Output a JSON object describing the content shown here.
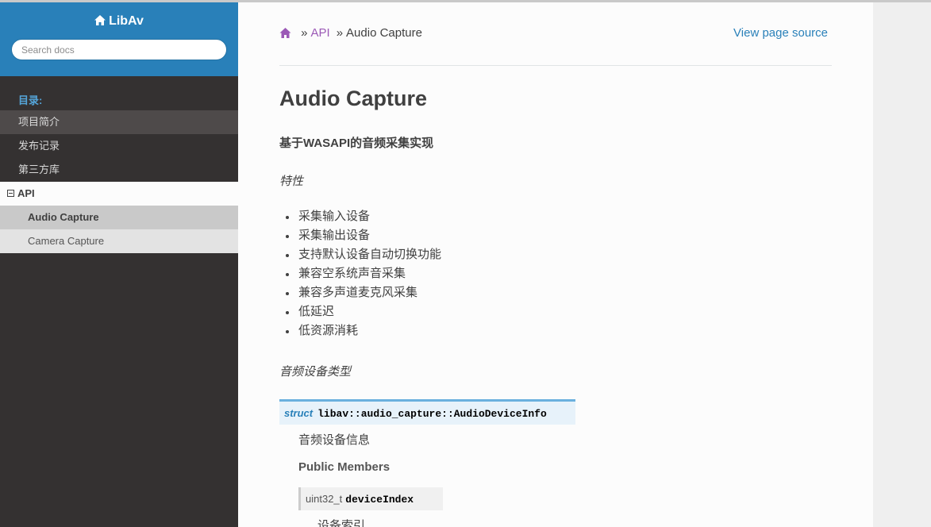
{
  "sidebar": {
    "brand": "LibAv",
    "search_placeholder": "Search docs",
    "caption": "目录:",
    "items": [
      {
        "label": "项目简介"
      },
      {
        "label": "发布记录"
      },
      {
        "label": "第三方库"
      },
      {
        "label": "API"
      },
      {
        "label": "Audio Capture"
      },
      {
        "label": "Camera Capture"
      }
    ]
  },
  "breadcrumb": {
    "sep1": "»",
    "api": "API",
    "sep2": "»",
    "current": "Audio Capture",
    "view_source": "View page source"
  },
  "main": {
    "title": "Audio Capture",
    "subtitle": "基于WASAPI的音频采集实现",
    "features_heading": "特性",
    "features": [
      "采集输入设备",
      "采集输出设备",
      "支持默认设备自动切换功能",
      "兼容空系统声音采集",
      "兼容多声道麦克风采集",
      "低延迟",
      "低资源消耗"
    ],
    "device_types_heading": "音频设备类型",
    "struct_keyword": "struct",
    "struct_name": "libav::audio_capture::AudioDeviceInfo",
    "struct_desc": "音频设备信息",
    "public_members": "Public Members",
    "member_type": "uint32_t",
    "member_name": "deviceIndex",
    "member_desc": "设备索引"
  }
}
